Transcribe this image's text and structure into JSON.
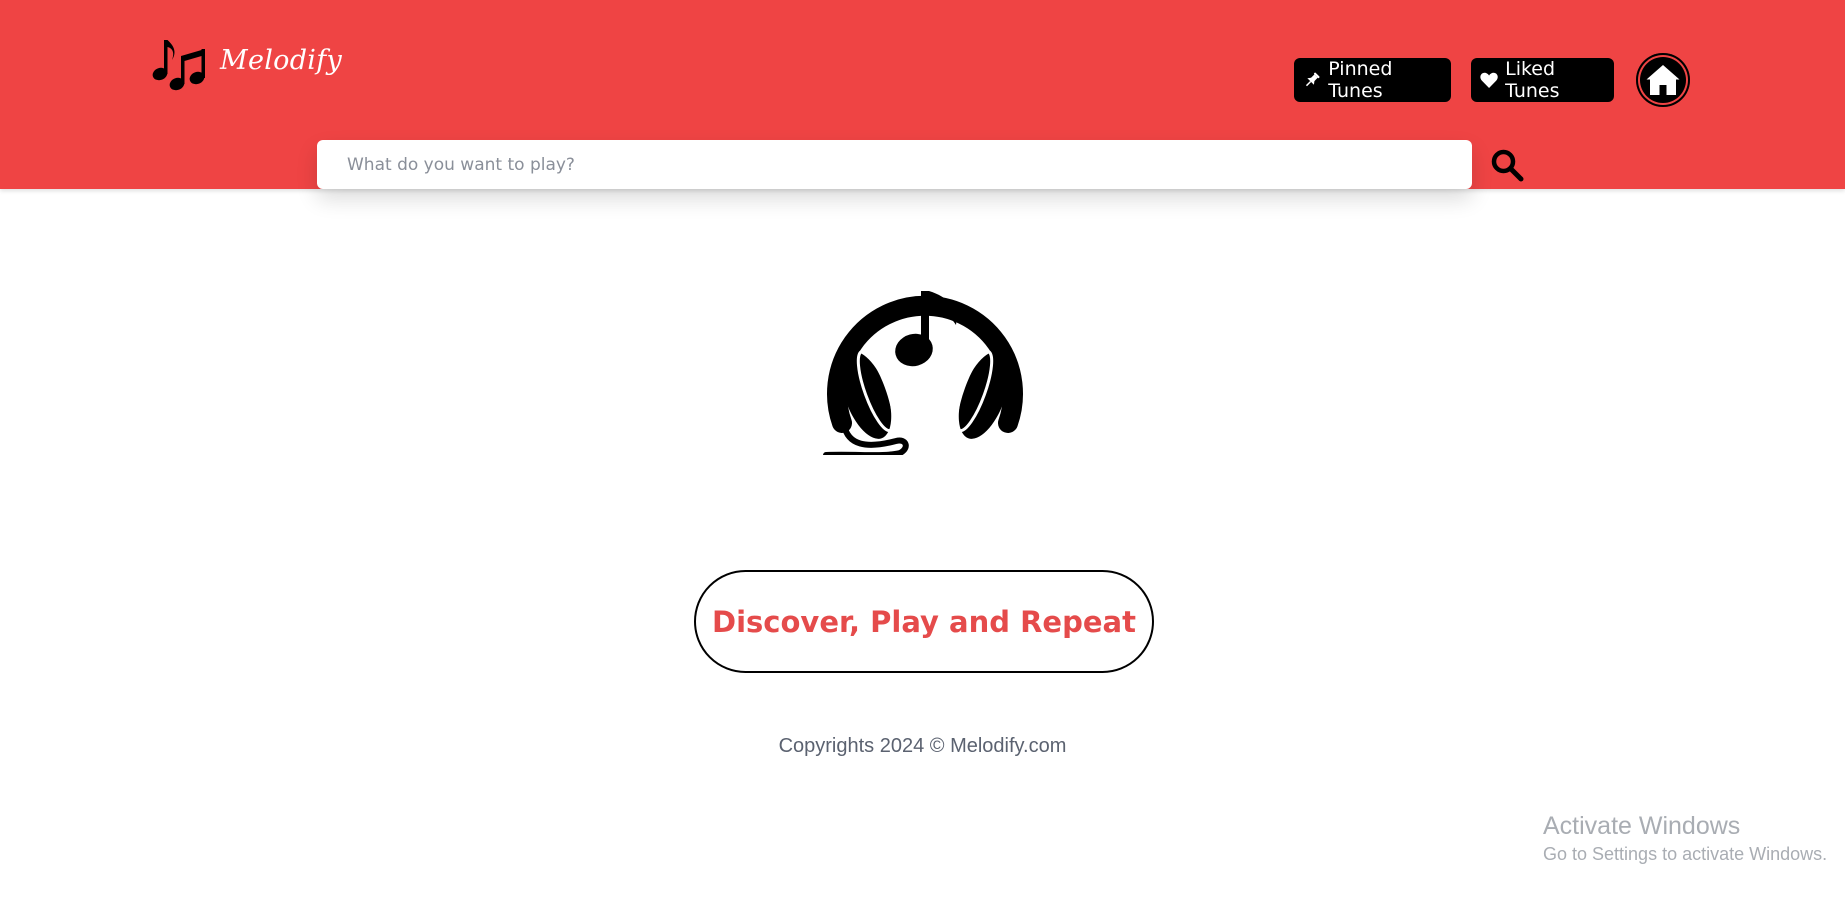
{
  "app": {
    "name": "Melodify"
  },
  "nav": {
    "pinned_label": "Pinned Tunes",
    "liked_label": "Liked Tunes",
    "pinned_icon": "pin-icon",
    "liked_icon": "heart-icon",
    "home_icon": "home-icon"
  },
  "search": {
    "placeholder": "What do you want to play?",
    "value": "",
    "button_icon": "search-icon"
  },
  "hero": {
    "icon": "headphones-music-icon"
  },
  "cta": {
    "label": "Discover, Play and Repeat"
  },
  "footer": {
    "text": "Copyrights 2024 © Melodify.com"
  },
  "watermark": {
    "title": "Activate Windows",
    "subtitle": "Go to Settings to activate Windows."
  },
  "colors": {
    "brand": "#ef4444",
    "cta_text": "#e54b4b",
    "button_bg": "#000000"
  }
}
